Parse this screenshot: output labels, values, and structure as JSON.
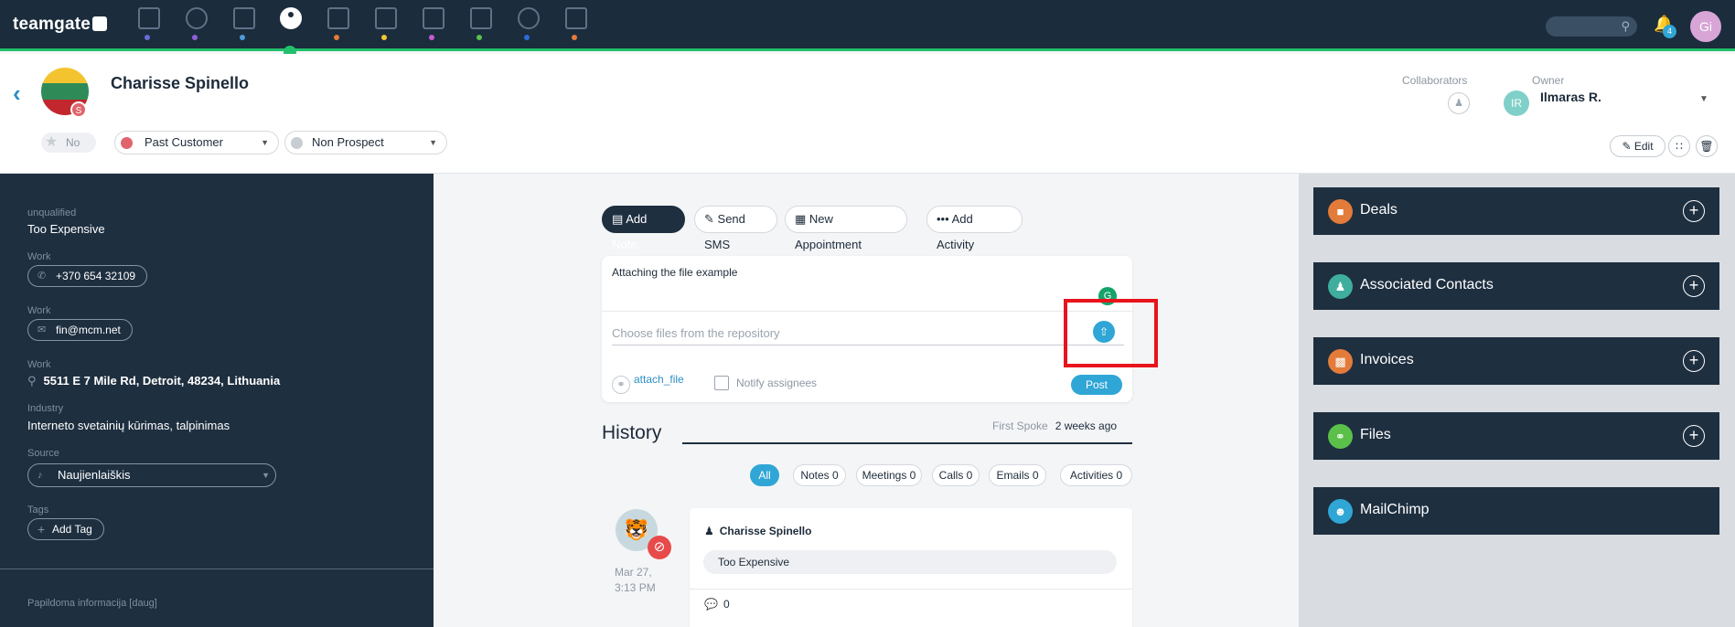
{
  "topbar": {
    "logo": "teamgate",
    "nav_icons": [
      {
        "name": "dashboard-icon",
        "dot": "#6b6bd6"
      },
      {
        "name": "target-icon",
        "dot": "#8f5fd8"
      },
      {
        "name": "companies-icon",
        "dot": "#4e9bd9"
      },
      {
        "name": "contacts-icon",
        "dot": "#23c06b",
        "active": true
      },
      {
        "name": "deals-icon",
        "dot": "#e37b3a"
      },
      {
        "name": "calendar-icon",
        "dot": "#f2c531"
      },
      {
        "name": "inbox-icon",
        "dot": "#c45bd0"
      },
      {
        "name": "invoice-icon",
        "dot": "#5ac04a"
      },
      {
        "name": "reports-icon",
        "dot": "#2e6bd8"
      },
      {
        "name": "forecast-icon",
        "dot": "#e37b3a"
      }
    ],
    "notifications_count": "4",
    "user_initials": "Gi"
  },
  "contact": {
    "name": "Charisse Spinello",
    "flag_badge": "S",
    "favorite_label": "No",
    "status": {
      "label": "Past Customer",
      "color": "#e0646b"
    },
    "prospect": {
      "label": "Non Prospect",
      "color": "#c8cdd3"
    }
  },
  "header": {
    "collaborators_label": "Collaborators",
    "owner_label": "Owner",
    "owner_initials": "IR",
    "owner_name": "Ilmaras R.",
    "edit_label": "Edit"
  },
  "details": {
    "unqualified_label": "unqualified",
    "unqualified_value": "Too Expensive",
    "phone_label": "Work",
    "phone_value": "+370 654 32109",
    "email_label": "Work",
    "email_value": "fin@mcm.net",
    "address_label": "Work",
    "address_value": "5511 E 7 Mile Rd, Detroit, 48234, Lithuania",
    "industry_label": "Industry",
    "industry_value": "Interneto svetainių kūrimas, talpinimas",
    "source_label": "Source",
    "source_value": "Naujienlaiškis",
    "tags_label": "Tags",
    "add_tag_label": "Add Tag",
    "extra_info": "Papildoma informacija [daug]"
  },
  "composer": {
    "tabs": [
      "Add Note",
      "Send SMS",
      "New Appointment",
      "Add Activity"
    ],
    "note_text": "Attaching the file example",
    "repo_placeholder": "Choose files from the repository",
    "attach_label": "attach_file",
    "notify_label": "Notify assignees",
    "post_label": "Post"
  },
  "history": {
    "title": "History",
    "first_spoke_label": "First Spoke",
    "first_spoke_value": "2 weeks ago",
    "filters": [
      "All",
      "Notes 0",
      "Meetings 0",
      "Calls 0",
      "Emails 0",
      "Activities 0"
    ],
    "entry": {
      "author": "Charisse Spinello",
      "date_line1": "Mar 27,",
      "date_line2": "3:13 PM",
      "value": "Too Expensive",
      "comments": "0"
    }
  },
  "sidebar_cards": [
    {
      "label": "Deals",
      "color": "#e37b3a",
      "icon": "briefcase-icon"
    },
    {
      "label": "Associated Contacts",
      "color": "#3fae9e",
      "icon": "person-icon"
    },
    {
      "label": "Invoices",
      "color": "#e37b3a",
      "icon": "invoice-icon"
    },
    {
      "label": "Files",
      "color": "#5ac04a",
      "icon": "paperclip-icon"
    },
    {
      "label": "MailChimp",
      "color": "#2fa6d6",
      "icon": "mailchimp-icon"
    }
  ]
}
